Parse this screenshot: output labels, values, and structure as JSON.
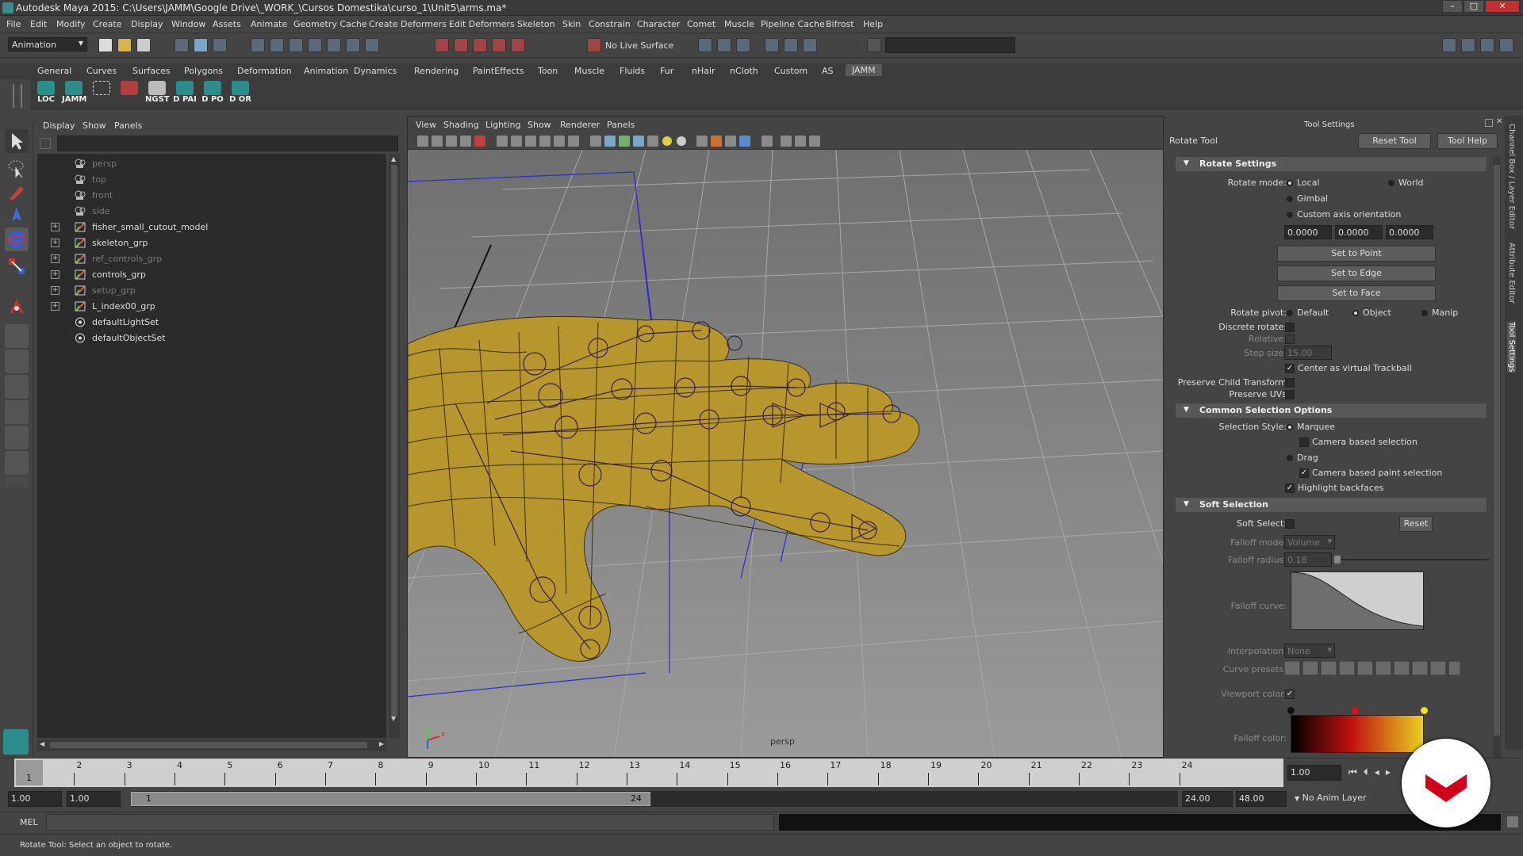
{
  "window": {
    "title": "Autodesk Maya 2015: C:\\Users\\JAMM\\Google Drive\\_WORK_\\Cursos Domestika\\curso_1\\Unit5\\arms.ma*"
  },
  "menubar": [
    "File",
    "Edit",
    "Modify",
    "Create",
    "Display",
    "Window",
    "Assets",
    "Animate",
    "Geometry Cache",
    "Create Deformers",
    "Edit Deformers",
    "Skeleton",
    "Skin",
    "Constrain",
    "Character",
    "Comet",
    "Muscle",
    "Pipeline Cache",
    "Bifrost",
    "Help"
  ],
  "statusline": {
    "menuset": "Animation",
    "live_surface": "No Live Surface"
  },
  "shelf_tabs": [
    "General",
    "Curves",
    "Surfaces",
    "Polygons",
    "Deformation",
    "Animation",
    "Dynamics",
    "Rendering",
    "PaintEffects",
    "Toon",
    "Muscle",
    "Fluids",
    "Fur",
    "nHair",
    "nCloth",
    "Custom",
    "AS",
    "JAMM"
  ],
  "shelf_buttons": [
    "LOC",
    "JAMM",
    "",
    "",
    "NGST",
    "D PAI",
    "D PO",
    "D OR"
  ],
  "outliner": {
    "menu": [
      "Display",
      "Show",
      "Panels"
    ],
    "items": [
      {
        "label": "persp",
        "kind": "camera",
        "dim": true,
        "expand": false
      },
      {
        "label": "top",
        "kind": "camera",
        "dim": true,
        "expand": false
      },
      {
        "label": "front",
        "kind": "camera",
        "dim": true,
        "expand": false
      },
      {
        "label": "side",
        "kind": "camera",
        "dim": true,
        "expand": false
      },
      {
        "label": "fisher_small_cutout_model",
        "kind": "group",
        "dim": false,
        "expand": true
      },
      {
        "label": "skeleton_grp",
        "kind": "group",
        "dim": false,
        "expand": true
      },
      {
        "label": "ref_controls_grp",
        "kind": "group",
        "dim": true,
        "expand": true
      },
      {
        "label": "controls_grp",
        "kind": "group",
        "dim": false,
        "expand": true
      },
      {
        "label": "setup_grp",
        "kind": "group",
        "dim": true,
        "expand": true
      },
      {
        "label": "L_index00_grp",
        "kind": "group",
        "dim": false,
        "expand": true
      },
      {
        "label": "defaultLightSet",
        "kind": "set",
        "dim": false,
        "expand": false
      },
      {
        "label": "defaultObjectSet",
        "kind": "set",
        "dim": false,
        "expand": false
      }
    ]
  },
  "viewport": {
    "menu": [
      "View",
      "Shading",
      "Lighting",
      "Show",
      "Renderer",
      "Panels"
    ],
    "camera": "persp"
  },
  "tool_settings": {
    "panel_title": "Tool Settings",
    "tool_name": "Rotate Tool",
    "reset_tool": "Reset Tool",
    "tool_help": "Tool Help",
    "rotate_settings": {
      "header": "Rotate Settings",
      "rotate_mode_label": "Rotate mode:",
      "local": "Local",
      "world": "World",
      "gimbal": "Gimbal",
      "custom_axis": "Custom axis orientation",
      "axis_values": [
        "0.0000",
        "0.0000",
        "0.0000"
      ],
      "set_to_point": "Set to Point",
      "set_to_edge": "Set to Edge",
      "set_to_face": "Set to Face",
      "rotate_pivot_label": "Rotate pivot:",
      "pivot_default": "Default",
      "pivot_object": "Object",
      "pivot_manip": "Manip",
      "discrete_rotate": "Discrete rotate:",
      "relative": "Relative:",
      "step_size": "Step size:",
      "step_value": "15.00",
      "center_trackball": "Center as virtual Trackball",
      "preserve_child": "Preserve Child Transform",
      "preserve_uvs": "Preserve UVs"
    },
    "common_selection": {
      "header": "Common Selection Options",
      "style_label": "Selection Style:",
      "marquee": "Marquee",
      "camera_based": "Camera based selection",
      "drag": "Drag",
      "camera_paint": "Camera based paint selection",
      "highlight_backfaces": "Highlight backfaces"
    },
    "soft_selection": {
      "header": "Soft Selection",
      "soft_select": "Soft Select:",
      "reset": "Reset",
      "falloff_mode": "Falloff mode:",
      "falloff_mode_value": "Volume",
      "falloff_radius": "Falloff radius:",
      "falloff_radius_value": "0.18",
      "falloff_curve": "Falloff curve:",
      "interpolation": "Interpolation:",
      "interpolation_value": "None",
      "curve_presets": "Curve presets:",
      "viewport_color": "Viewport color:",
      "falloff_color": "Falloff color:"
    }
  },
  "side_tabs": [
    "Channel Box / Layer Editor",
    "Attribute Editor",
    "Tool Settings"
  ],
  "timeline": {
    "ticks": [
      "1",
      "2",
      "3",
      "4",
      "5",
      "6",
      "7",
      "8",
      "9",
      "10",
      "11",
      "12",
      "13",
      "14",
      "15",
      "16",
      "17",
      "18",
      "19",
      "20",
      "21",
      "22",
      "23",
      "24"
    ],
    "current_frame": "1",
    "current_field": "1.00"
  },
  "range": {
    "start": "1.00",
    "start2": "1.00",
    "range_start": "1",
    "range_end": "24",
    "end": "24.00",
    "end2": "48.00",
    "anim_layer": "No Anim Layer"
  },
  "cmdline": {
    "label": "MEL"
  },
  "helpline": {
    "text": "Rotate Tool: Select an object to rotate."
  },
  "colors": {
    "mesh": "#b8962e",
    "wire": "#3a2f14",
    "grid": "#9a9a9a",
    "accent_blue": "#2b2bd0",
    "logo_red": "#d0021b"
  }
}
